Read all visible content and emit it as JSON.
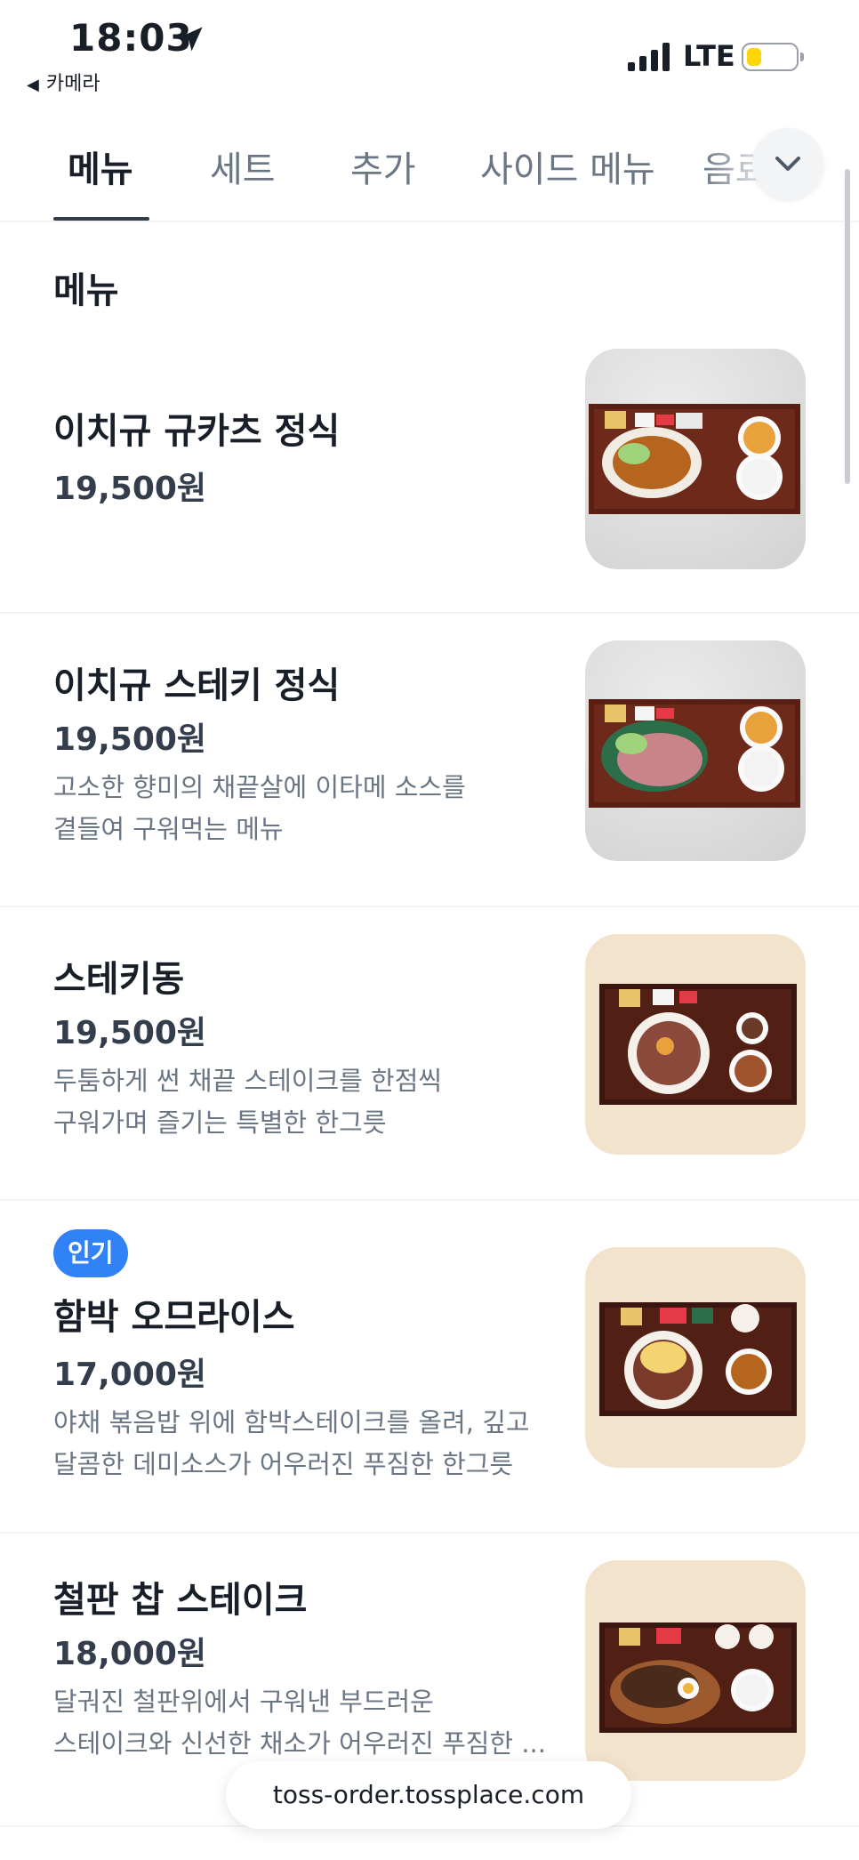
{
  "status_bar": {
    "time": "18:03",
    "back_app": "카메라",
    "network": "LTE"
  },
  "tabs": [
    {
      "label": "메뉴",
      "active": true
    },
    {
      "label": "세트",
      "active": false
    },
    {
      "label": "추가",
      "active": false
    },
    {
      "label": "사이드 메뉴",
      "active": false
    },
    {
      "label": "음료",
      "active": false
    }
  ],
  "section": {
    "title": "메뉴"
  },
  "menu_items": [
    {
      "name": "이치규 규카츠 정식",
      "price": "19,500원",
      "desc1": "",
      "desc2": "",
      "badge": ""
    },
    {
      "name": "이치규 스테키 정식",
      "price": "19,500원",
      "desc1": "고소한 향미의 채끝살에 이타메 소스를",
      "desc2": "곁들여 구워먹는 메뉴",
      "badge": ""
    },
    {
      "name": "스테키동",
      "price": "19,500원",
      "desc1": "두툼하게 썬 채끝 스테이크를 한점씩",
      "desc2": "구워가며 즐기는 특별한 한그릇",
      "badge": ""
    },
    {
      "name": "함박 오므라이스",
      "price": "17,000원",
      "desc1": "야채 볶음밥 위에 함박스테이크를 올려, 깊고",
      "desc2": "달콤한 데미소스가 어우러진 푸짐한 한그릇",
      "badge": "인기"
    },
    {
      "name": "철판 찹 스테이크",
      "price": "18,000원",
      "desc1": "달궈진 철판위에서 구워낸 부드러운",
      "desc2": "스테이크와 신선한 채소가 어우러진 푸짐한 ...",
      "badge": ""
    }
  ],
  "url_bar": {
    "text": "toss-order.tossplace.com"
  }
}
